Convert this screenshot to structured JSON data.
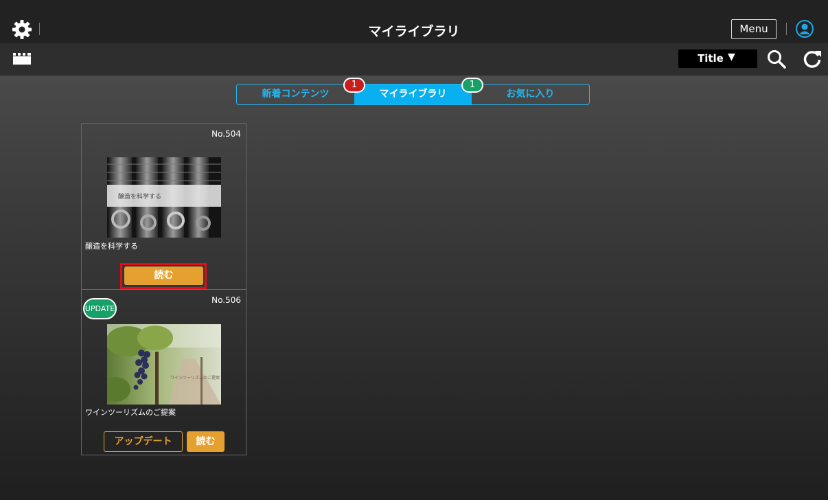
{
  "header": {
    "title": "マイライブラリ",
    "menu_label": "Menu"
  },
  "toolbar": {
    "sort_label": "Title",
    "sort_arrow": "▼"
  },
  "tabs": [
    {
      "label": "新着コンテンツ",
      "active": false
    },
    {
      "label": "マイライブラリ",
      "active": true
    },
    {
      "label": "お気に入り",
      "active": false
    }
  ],
  "badges": {
    "new_count": "1",
    "favorite_count": "1"
  },
  "cards": [
    {
      "number": "No.504",
      "thumb_text": "醸造を科学する",
      "title": "醸造を科学する",
      "read_label": "読む"
    },
    {
      "number": "No.506",
      "update_label": "UPDATE",
      "thumb_text": "ワインツーリズムのご提案",
      "title": "ワインツーリズムのご提案",
      "update_button_label": "アップデート",
      "read_label": "読む"
    }
  ],
  "colors": {
    "accent_blue": "#09b0ef",
    "orange": "#e6a02f",
    "red_badge": "#c81e1e",
    "green_badge": "#17a067",
    "highlight": "#e30d17"
  },
  "icons": [
    "gear-icon",
    "clapperboard-icon",
    "user-icon",
    "search-icon",
    "refresh-icon"
  ]
}
